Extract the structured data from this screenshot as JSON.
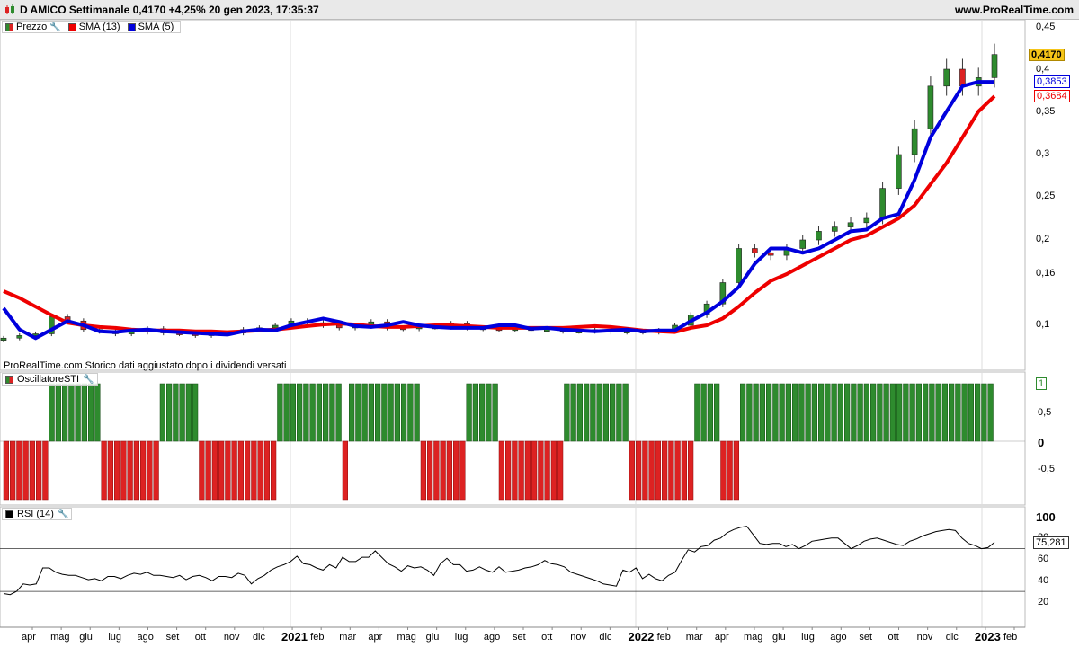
{
  "header": {
    "title": "D AMICO Settimanale 0,4170 +4,25% 20 gen 2023, 17:35:37",
    "site": "www.ProRealTime.com"
  },
  "price_panel": {
    "legend": [
      {
        "label": "Prezzo",
        "color": "#2e8b2e",
        "icon": "candle-icon"
      },
      {
        "label": "SMA (13)",
        "color": "#ee0000"
      },
      {
        "label": "SMA (5)",
        "color": "#0000dd"
      }
    ],
    "note": "ProRealTime.com Storico dati aggiustato dopo i dividendi versati",
    "y_ticks": [
      "0,45",
      "0,4",
      "0,35",
      "0,3",
      "0,25",
      "0,2",
      "0,16",
      "0,1"
    ],
    "last_price": "0,4170",
    "sma5_value": "0,3853",
    "sma13_value": "0,3684"
  },
  "osc_panel": {
    "legend": "OscillatoreSTI",
    "y_ticks": [
      "1",
      "0,5",
      "0",
      "-0,5"
    ]
  },
  "rsi_panel": {
    "legend": "RSI (14)",
    "y_ticks": [
      "100",
      "80",
      "60",
      "40",
      "20"
    ],
    "value": "75,281",
    "levels": [
      70,
      30
    ]
  },
  "x_axis": {
    "labels": [
      "apr",
      "mag",
      "giu",
      "lug",
      "ago",
      "set",
      "ott",
      "nov",
      "dic",
      "2021",
      "feb",
      "mar",
      "apr",
      "mag",
      "giu",
      "lug",
      "ago",
      "set",
      "ott",
      "nov",
      "dic",
      "2022",
      "feb",
      "mar",
      "apr",
      "mag",
      "giu",
      "lug",
      "ago",
      "set",
      "ott",
      "nov",
      "dic",
      "2023",
      "feb"
    ]
  },
  "colors": {
    "up": "#2e8b2e",
    "down": "#dd2222",
    "sma13": "#ee0000",
    "sma5": "#0000dd"
  },
  "chart_data": [
    {
      "type": "line",
      "title": "D AMICO Settimanale",
      "series": [
        {
          "name": "SMA (13)",
          "values": [
            0.14,
            0.132,
            0.122,
            0.112,
            0.103,
            0.1,
            0.098,
            0.097,
            0.095,
            0.094,
            0.094,
            0.094,
            0.093,
            0.093,
            0.092,
            0.093,
            0.094,
            0.095,
            0.097,
            0.099,
            0.101,
            0.102,
            0.101,
            0.099,
            0.098,
            0.098,
            0.099,
            0.1,
            0.1,
            0.099,
            0.098,
            0.097,
            0.097,
            0.097,
            0.097,
            0.097,
            0.098,
            0.099,
            0.098,
            0.096,
            0.094,
            0.093,
            0.092,
            0.097,
            0.1,
            0.108,
            0.122,
            0.138,
            0.152,
            0.16,
            0.17,
            0.18,
            0.19,
            0.2,
            0.205,
            0.215,
            0.225,
            0.24,
            0.265,
            0.29,
            0.32,
            0.35,
            0.368
          ]
        },
        {
          "name": "SMA (5)",
          "values": [
            0.12,
            0.095,
            0.085,
            0.095,
            0.105,
            0.1,
            0.093,
            0.092,
            0.094,
            0.095,
            0.093,
            0.092,
            0.091,
            0.09,
            0.089,
            0.093,
            0.095,
            0.094,
            0.1,
            0.104,
            0.108,
            0.104,
            0.099,
            0.098,
            0.1,
            0.104,
            0.1,
            0.098,
            0.097,
            0.097,
            0.097,
            0.1,
            0.1,
            0.096,
            0.097,
            0.095,
            0.094,
            0.093,
            0.094,
            0.095,
            0.093,
            0.094,
            0.094,
            0.105,
            0.115,
            0.128,
            0.145,
            0.172,
            0.19,
            0.19,
            0.185,
            0.19,
            0.2,
            0.21,
            0.212,
            0.225,
            0.23,
            0.27,
            0.32,
            0.35,
            0.38,
            0.385,
            0.385
          ]
        }
      ],
      "close": [
        0.085,
        0.088,
        0.09,
        0.11,
        0.105,
        0.095,
        0.093,
        0.09,
        0.092,
        0.096,
        0.091,
        0.09,
        0.088,
        0.09,
        0.091,
        0.095,
        0.097,
        0.1,
        0.105,
        0.103,
        0.1,
        0.097,
        0.099,
        0.104,
        0.097,
        0.096,
        0.098,
        0.098,
        0.102,
        0.097,
        0.096,
        0.095,
        0.096,
        0.095,
        0.095,
        0.093,
        0.093,
        0.095,
        0.092,
        0.093,
        0.092,
        0.094,
        0.1,
        0.112,
        0.125,
        0.15,
        0.19,
        0.185,
        0.182,
        0.19,
        0.2,
        0.21,
        0.215,
        0.22,
        0.225,
        0.26,
        0.3,
        0.33,
        0.38,
        0.4,
        0.38,
        0.39,
        0.417
      ]
    },
    {
      "type": "bar",
      "title": "OscillatoreSTI",
      "values": [
        -1,
        -1,
        -1,
        -1,
        -1,
        -1,
        -1,
        1,
        1,
        1,
        1,
        1,
        1,
        1,
        1,
        -1,
        -1,
        -1,
        -1,
        -1,
        -1,
        -1,
        -1,
        -1,
        1,
        1,
        1,
        1,
        1,
        1,
        -1,
        -1,
        -1,
        -1,
        -1,
        -1,
        -1,
        -1,
        -1,
        -1,
        -1,
        -1,
        1,
        1,
        1,
        1,
        1,
        1,
        1,
        1,
        1,
        1,
        -1,
        1,
        1,
        1,
        1,
        1,
        1,
        1,
        1,
        1,
        1,
        1,
        -1,
        -1,
        -1,
        -1,
        -1,
        -1,
        -1,
        1,
        1,
        1,
        1,
        1,
        -1,
        -1,
        -1,
        -1,
        -1,
        -1,
        -1,
        -1,
        -1,
        -1,
        1,
        1,
        1,
        1,
        1,
        1,
        1,
        1,
        1,
        1,
        -1,
        -1,
        -1,
        -1,
        -1,
        -1,
        -1,
        -1,
        -1,
        -1,
        1,
        1,
        1,
        1,
        -1,
        -1,
        -1,
        1,
        1,
        1,
        1,
        1,
        1,
        1,
        1,
        1,
        1,
        1,
        1,
        1,
        1,
        1,
        1,
        1,
        1,
        1,
        1,
        1,
        1,
        1,
        1,
        1,
        1,
        1,
        1,
        1,
        1,
        1,
        1,
        1,
        1,
        1,
        1,
        1,
        1,
        1
      ],
      "ylim": [
        -1,
        1
      ]
    },
    {
      "type": "line",
      "title": "RSI (14)",
      "values": [
        28,
        27,
        30,
        37,
        36,
        37,
        52,
        52,
        48,
        46,
        45,
        45,
        43,
        41,
        42,
        40,
        44,
        44,
        42,
        45,
        47,
        46,
        48,
        45,
        45,
        44,
        43,
        45,
        41,
        44,
        45,
        43,
        40,
        44,
        44,
        43,
        47,
        45,
        37,
        42,
        45,
        50,
        53,
        55,
        58,
        63,
        56,
        55,
        52,
        50,
        55,
        52,
        62,
        58,
        58,
        62,
        62,
        68,
        62,
        56,
        53,
        49,
        54,
        52,
        53,
        50,
        45,
        56,
        61,
        55,
        55,
        49,
        50,
        53,
        50,
        48,
        53,
        48,
        49,
        50,
        52,
        53,
        55,
        59,
        56,
        55,
        53,
        48,
        46,
        44,
        42,
        40,
        37,
        36,
        35,
        50,
        48,
        52,
        42,
        46,
        42,
        40,
        45,
        48,
        59,
        69,
        67,
        72,
        73,
        78,
        80,
        85,
        88,
        90,
        91,
        83,
        75,
        74,
        75,
        75,
        72,
        74,
        70,
        73,
        77,
        78,
        79,
        80,
        80,
        75,
        70,
        73,
        77,
        79,
        80,
        78,
        76,
        74,
        73,
        77,
        79,
        82,
        84,
        86,
        87,
        88,
        87,
        80,
        75,
        73,
        70,
        71,
        76
      ]
    }
  ]
}
